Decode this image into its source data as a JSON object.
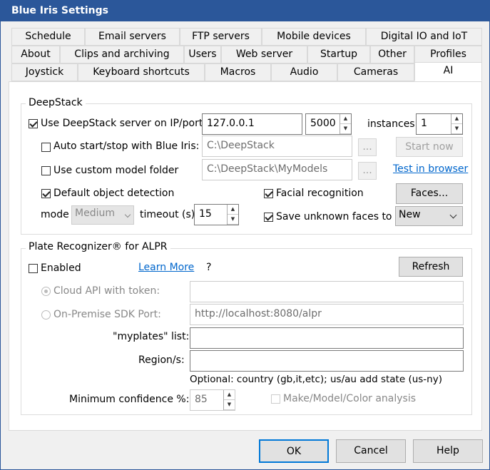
{
  "window": {
    "title": "Blue Iris Settings"
  },
  "tabs": {
    "row1": [
      "Schedule",
      "Email servers",
      "FTP servers",
      "Mobile devices",
      "Digital IO and IoT"
    ],
    "row2": [
      "About",
      "Clips and archiving",
      "Users",
      "Web server",
      "Startup",
      "Other",
      "Profiles"
    ],
    "row3": [
      "Joystick",
      "Keyboard shortcuts",
      "Macros",
      "Audio",
      "Cameras",
      "AI"
    ],
    "active": "AI"
  },
  "deepstack": {
    "group_title": "DeepStack",
    "use_server_label": "Use DeepStack server on IP/port:",
    "use_server_checked": true,
    "ip": "127.0.0.1",
    "port": "5000",
    "instances_label": "instances:",
    "instances": "1",
    "auto_start_label": "Auto start/stop with Blue Iris:",
    "auto_start_path": "C:\\DeepStack",
    "browse1": "...",
    "start_now": "Start now",
    "custom_model_label": "Use custom model folder",
    "custom_model_path": "C:\\DeepStack\\MyModels",
    "browse2": "...",
    "test_browser": "Test in browser",
    "default_detection_label": "Default object detection",
    "facial_label": "Facial recognition",
    "faces_button": "Faces...",
    "mode_label": "mode",
    "mode_value": "Medium",
    "timeout_label": "timeout (s)",
    "timeout_value": "15",
    "save_unknown_label": "Save unknown faces to",
    "save_unknown_value": "New"
  },
  "plate": {
    "group_title": "Plate Recognizer® for ALPR",
    "enabled_label": "Enabled",
    "learn_more": "Learn More",
    "help_q": "?",
    "refresh": "Refresh",
    "cloud_label": "Cloud API with token:",
    "cloud_value": "",
    "onprem_label": "On-Premise SDK Port:",
    "onprem_value": "http://localhost:8080/alpr",
    "myplates_label": "\"myplates\" list:",
    "myplates_value": "",
    "region_label": "Region/s:",
    "region_value": "",
    "optional_note": "Optional: country (gb,it,etc); us/au add state (us-ny)",
    "min_conf_label": "Minimum confidence %:",
    "min_conf_value": "85",
    "mmc_label": "Make/Model/Color analysis"
  },
  "footer": {
    "ok": "OK",
    "cancel": "Cancel",
    "help": "Help"
  }
}
